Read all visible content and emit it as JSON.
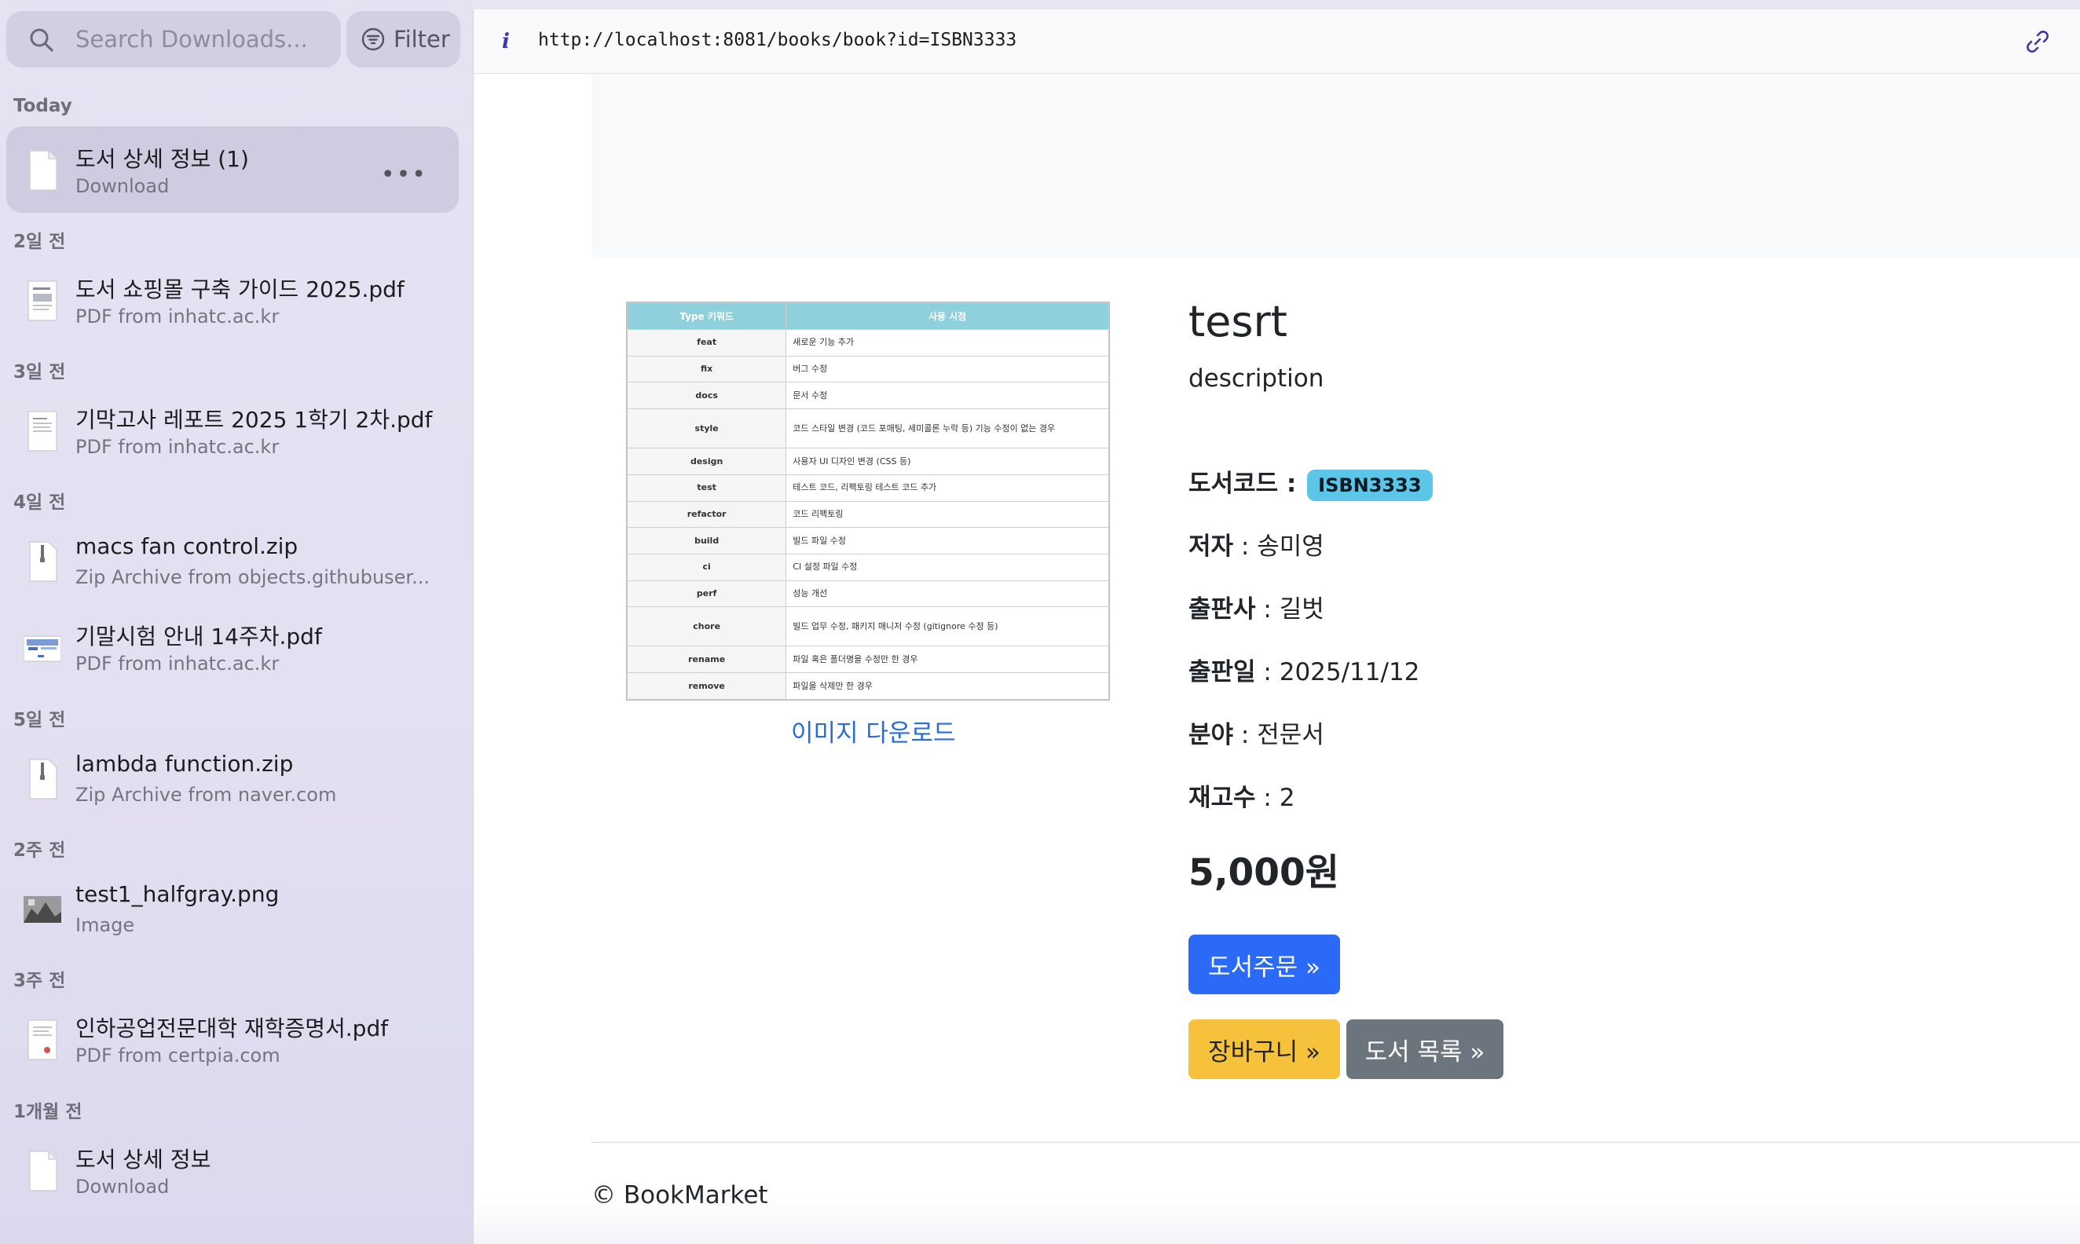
{
  "sidebar": {
    "search": {
      "placeholder": "Search Downloads..."
    },
    "filter_label": "Filter",
    "sections": [
      {
        "label": "Today",
        "items": [
          {
            "title": "도서 상세 정보 (1)",
            "subtitle": "Download",
            "icon": "document-icon",
            "selected": true
          }
        ]
      },
      {
        "label": "2일 전",
        "items": [
          {
            "title": "도서 쇼핑몰 구축 가이드 2025.pdf",
            "subtitle": "PDF from inhatc.ac.kr",
            "icon": "pdf-thumbnail"
          }
        ]
      },
      {
        "label": "3일 전",
        "items": [
          {
            "title": "기막고사 레포트 2025 1학기 2차.pdf",
            "subtitle": "PDF from inhatc.ac.kr",
            "icon": "pdf-thumbnail"
          }
        ]
      },
      {
        "label": "4일 전",
        "items": [
          {
            "title": "macs fan control.zip",
            "subtitle": "Zip Archive from objects.githubuser...",
            "icon": "zip-icon"
          },
          {
            "title": "기말시험 안내 14주차.pdf",
            "subtitle": "PDF from inhatc.ac.kr",
            "icon": "pdf-thumbnail"
          }
        ]
      },
      {
        "label": "5일 전",
        "items": [
          {
            "title": "lambda function.zip",
            "subtitle": "Zip Archive from naver.com",
            "icon": "zip-icon"
          }
        ]
      },
      {
        "label": "2주 전",
        "items": [
          {
            "title": "test1_halfgray.png",
            "subtitle": "Image",
            "icon": "image-thumbnail"
          }
        ]
      },
      {
        "label": "3주 전",
        "items": [
          {
            "title": "인하공업전문대학 재학증명서.pdf",
            "subtitle": "PDF from certpia.com",
            "icon": "pdf-thumbnail"
          }
        ]
      },
      {
        "label": "1개월 전",
        "items": [
          {
            "title": "도서 상세 정보",
            "subtitle": "Download",
            "icon": "document-icon"
          }
        ]
      }
    ]
  },
  "browser": {
    "url": "http://localhost:8081/books/book?id=ISBN3333",
    "book": {
      "title": "tesrt",
      "description": "description",
      "code_label": "도서코드 :",
      "code": "ISBN3333",
      "author_label": "저자",
      "author": " : 송미영",
      "publisher_label": "출판사",
      "publisher": " : 길벗",
      "date_label": "출판일",
      "date": " : 2025/11/12",
      "category_label": "분야",
      "category": " : 전문서",
      "stock_label": "재고수",
      "stock": " : 2",
      "price": "5,000원",
      "image_download": "이미지 다운로드"
    },
    "buttons": {
      "order": "도서주문 »",
      "cart": "장바구니 »",
      "list": "도서 목록 »"
    },
    "footer": "© BookMarket",
    "image_table": {
      "headers": [
        "Type 키워드",
        "사용 시점"
      ],
      "rows": [
        [
          "feat",
          "새로운 기능 추가"
        ],
        [
          "fix",
          "버그 수정"
        ],
        [
          "docs",
          "문서 수정"
        ],
        [
          "style",
          "코드 스타일 변경 (코드 포매팅, 세미콜론 누락 등) 기능 수정이 없는 경우"
        ],
        [
          "design",
          "사용자 UI 디자인 변경 (CSS 등)"
        ],
        [
          "test",
          "테스트 코드, 리팩토링 테스트 코드 추가"
        ],
        [
          "refactor",
          "코드 리팩토링"
        ],
        [
          "build",
          "빌드 파일 수정"
        ],
        [
          "ci",
          "CI 설정 파일 수정"
        ],
        [
          "perf",
          "성능 개선"
        ],
        [
          "chore",
          "빌드 업무 수정, 패키지 매니저 수정 (gitignore 수정 등)"
        ],
        [
          "rename",
          "파일 혹은 폴더명을 수정만 한 경우"
        ],
        [
          "remove",
          "파일을 삭제만 한 경우"
        ]
      ]
    }
  }
}
